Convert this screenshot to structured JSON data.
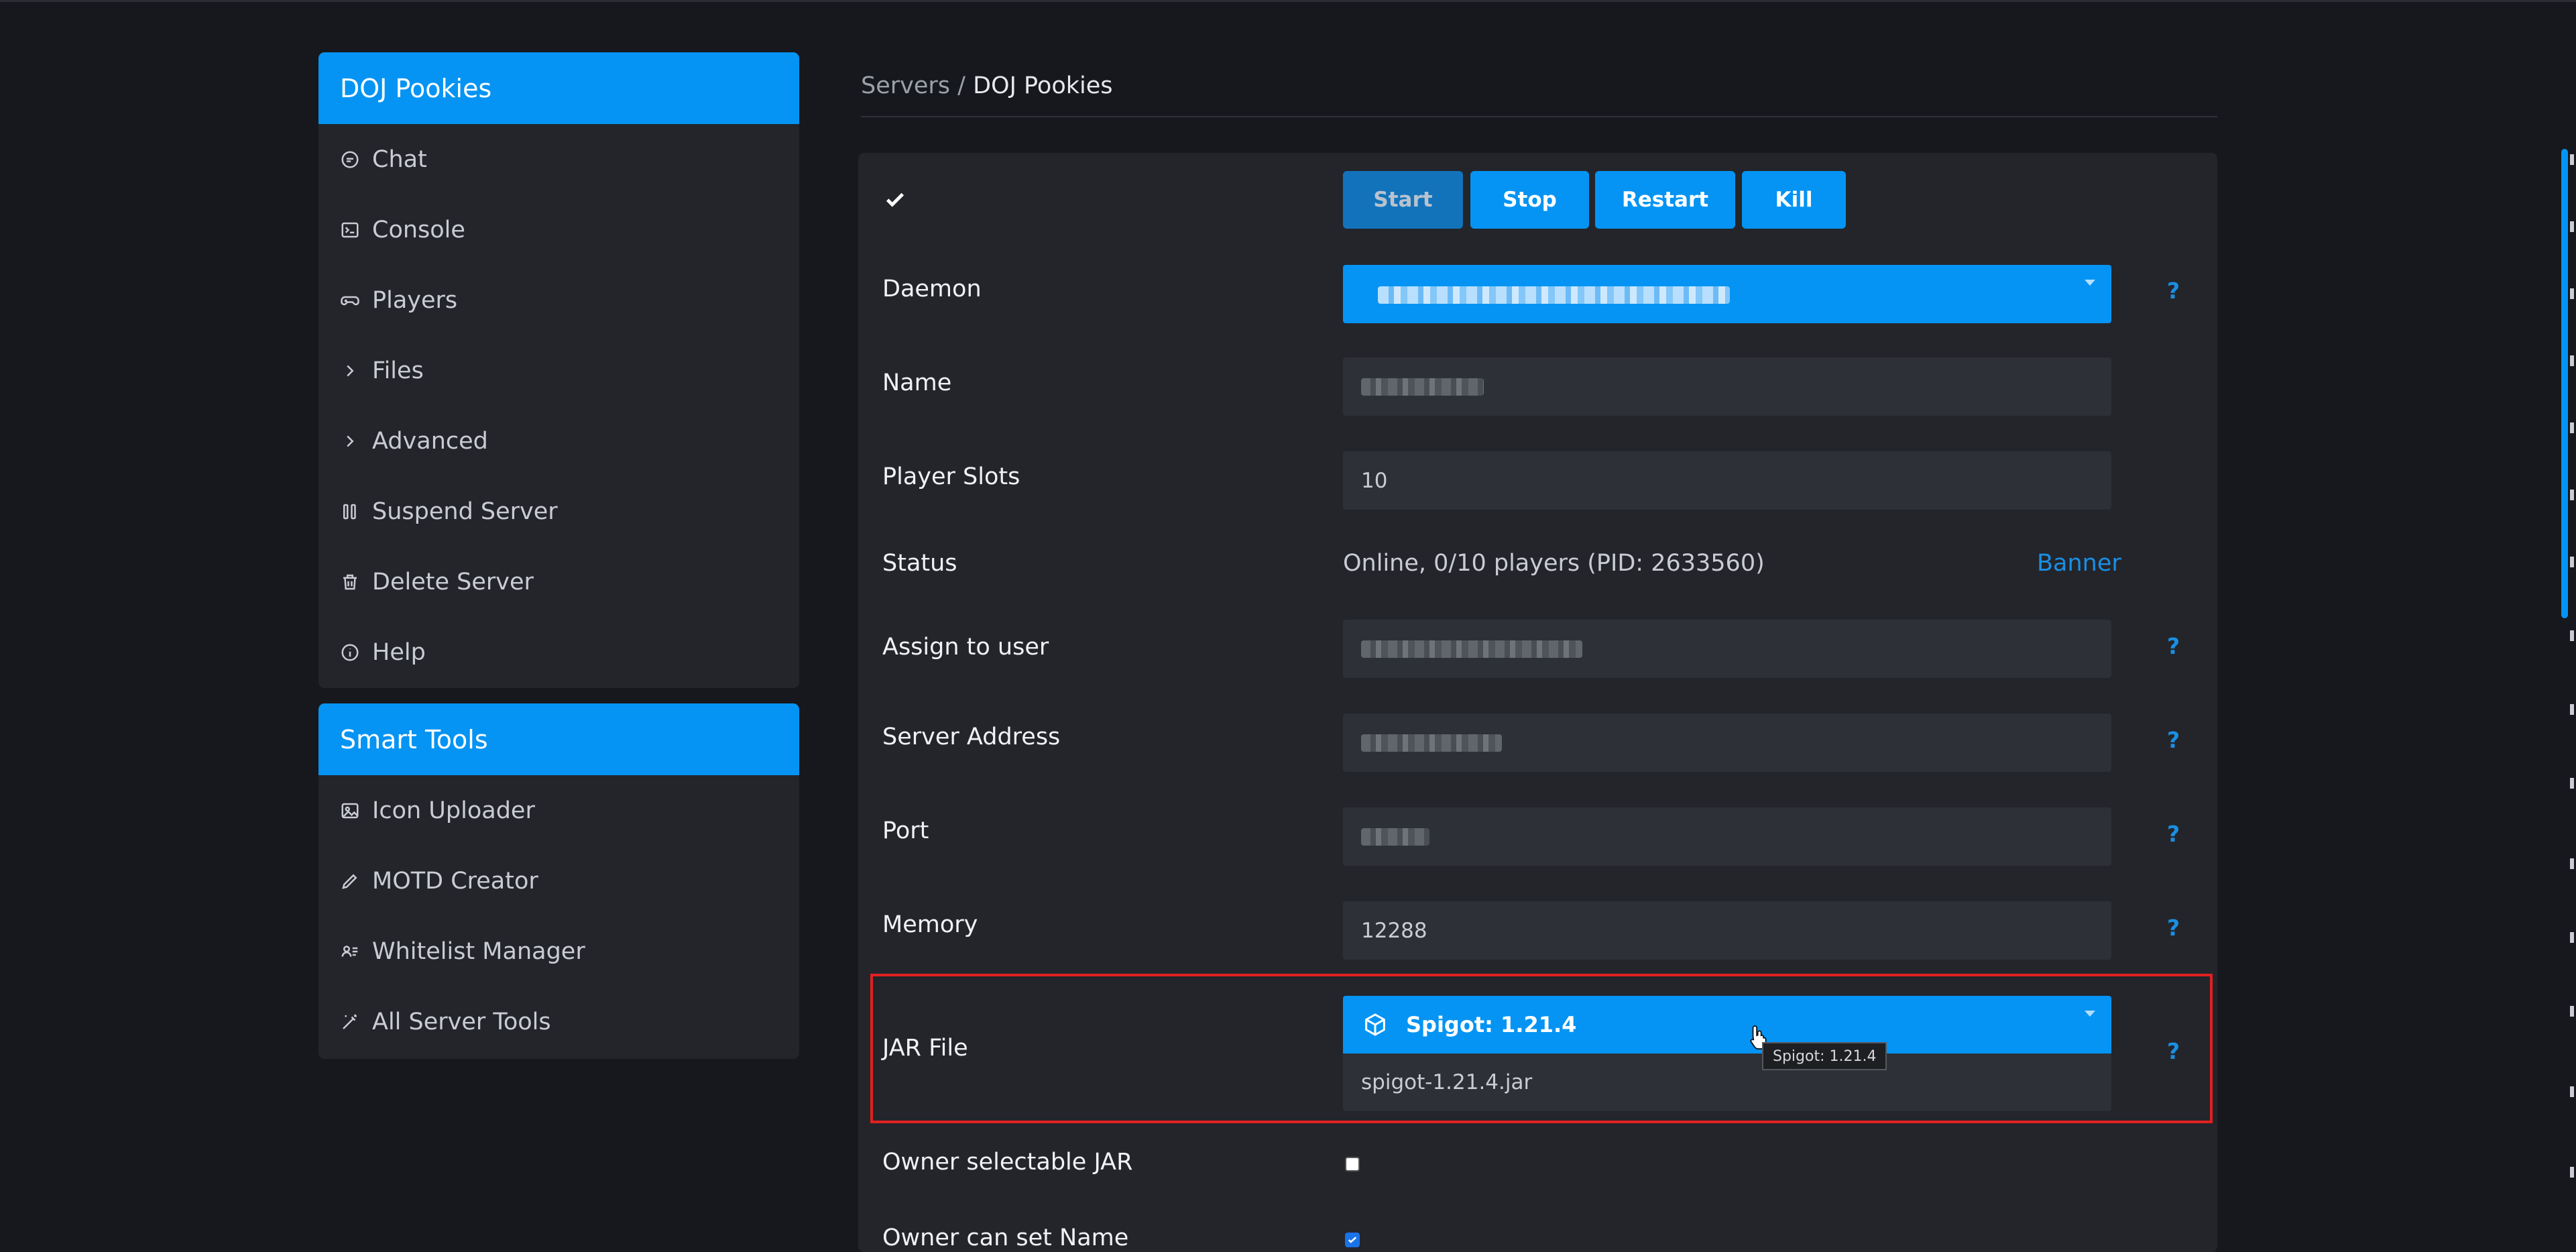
{
  "sidebar": {
    "server_title": "DOJ Pookies",
    "items": [
      {
        "label": "Chat",
        "icon": "chat-bubble-icon"
      },
      {
        "label": "Console",
        "icon": "terminal-icon"
      },
      {
        "label": "Players",
        "icon": "gamepad-icon"
      },
      {
        "label": "Files",
        "icon": "chevron-right-icon"
      },
      {
        "label": "Advanced",
        "icon": "chevron-right-icon"
      },
      {
        "label": "Suspend Server",
        "icon": "pause-icon"
      },
      {
        "label": "Delete Server",
        "icon": "trash-icon"
      },
      {
        "label": "Help",
        "icon": "info-icon"
      }
    ],
    "tools_title": "Smart Tools",
    "tools": [
      {
        "label": "Icon Uploader",
        "icon": "image-icon"
      },
      {
        "label": "MOTD Creator",
        "icon": "pencil-icon"
      },
      {
        "label": "Whitelist Manager",
        "icon": "user-list-icon"
      },
      {
        "label": "All Server Tools",
        "icon": "magic-wand-icon"
      }
    ]
  },
  "breadcrumb": {
    "parent": "Servers",
    "separator": "/",
    "current": "DOJ Pookies"
  },
  "controls": {
    "start": "Start",
    "stop": "Stop",
    "restart": "Restart",
    "kill": "Kill"
  },
  "form": {
    "daemon_label": "Daemon",
    "name_label": "Name",
    "player_slots_label": "Player Slots",
    "player_slots_value": "10",
    "status_label": "Status",
    "status_value": "Online, 0/10 players (PID: 2633560)",
    "banner_link": "Banner",
    "assign_user_label": "Assign to user",
    "server_address_label": "Server Address",
    "port_label": "Port",
    "memory_label": "Memory",
    "memory_value": "12288",
    "jar_label": "JAR File",
    "jar_selected": "Spigot: 1.21.4",
    "jar_filename": "spigot-1.21.4.jar",
    "jar_tooltip": "Spigot: 1.21.4",
    "owner_jar_label": "Owner selectable JAR",
    "owner_jar_checked": false,
    "owner_name_label": "Owner can set Name",
    "owner_name_checked": true,
    "help_mark": "?"
  },
  "colors": {
    "accent": "#0594f3",
    "highlight": "#e02020",
    "link": "#1a8fe3"
  }
}
